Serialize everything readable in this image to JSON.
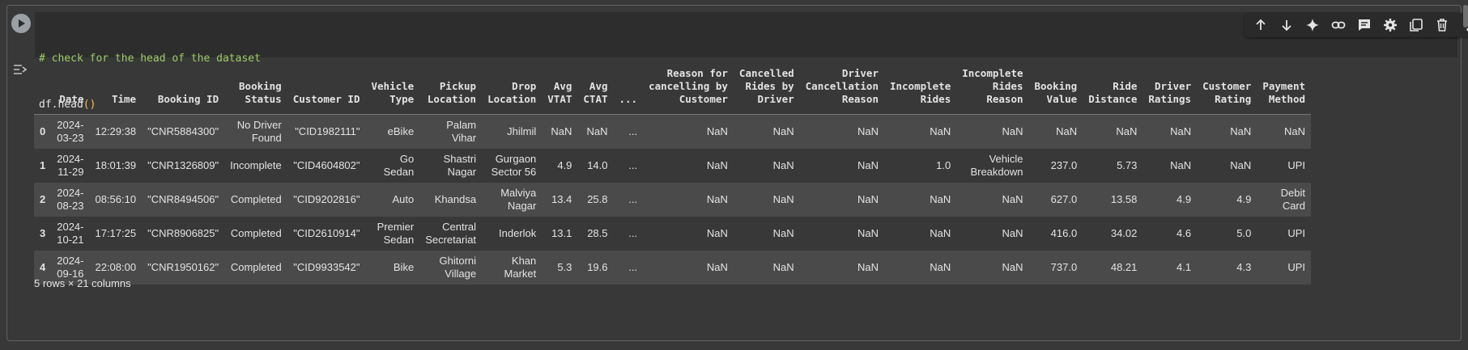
{
  "code": {
    "comment": "# check for the head of the dataset",
    "line2_prefix": "df.head",
    "line2_parens": "()"
  },
  "toolbar": {
    "icons": [
      "arrow-up-icon",
      "arrow-down-icon",
      "sparkle-icon",
      "link-icon",
      "comment-icon",
      "gear-icon",
      "mirror-cell-icon",
      "delete-icon",
      "more-vert-icon"
    ]
  },
  "table": {
    "index_header": "",
    "columns": [
      "Date",
      "Time",
      "Booking ID",
      "Booking Status",
      "Customer ID",
      "Vehicle Type",
      "Pickup Location",
      "Drop Location",
      "Avg VTAT",
      "Avg CTAT",
      "...",
      "Reason for cancelling by Customer",
      "Cancelled Rides by Driver",
      "Driver Cancellation Reason",
      "Incomplete Rides",
      "Incomplete Rides Reason",
      "Booking Value",
      "Ride Distance",
      "Driver Ratings",
      "Customer Rating",
      "Payment Method"
    ],
    "header_lines": [
      [
        "",
        "Date"
      ],
      [
        "",
        "Time"
      ],
      [
        "",
        "Booking ID"
      ],
      [
        "Booking",
        "Status"
      ],
      [
        "",
        "Customer ID"
      ],
      [
        "Vehicle",
        "Type"
      ],
      [
        "Pickup",
        "Location"
      ],
      [
        "Drop",
        "Location"
      ],
      [
        "Avg",
        "VTAT"
      ],
      [
        "Avg",
        "CTAT"
      ],
      [
        "",
        "..."
      ],
      [
        "Reason for",
        "cancelling by",
        "Customer"
      ],
      [
        "Cancelled",
        "Rides by",
        "Driver"
      ],
      [
        "Driver",
        "Cancellation",
        "Reason"
      ],
      [
        "Incomplete",
        "Rides"
      ],
      [
        "Incomplete",
        "Rides",
        "Reason"
      ],
      [
        "Booking",
        "Value"
      ],
      [
        "Ride",
        "Distance"
      ],
      [
        "Driver",
        "Ratings"
      ],
      [
        "Customer",
        "Rating"
      ],
      [
        "Payment",
        "Method"
      ]
    ],
    "rows": [
      {
        "index": "0",
        "cells": [
          [
            "2024-",
            "03-23"
          ],
          [
            "12:29:38"
          ],
          [
            "\"CNR5884300\""
          ],
          [
            "No Driver",
            "Found"
          ],
          [
            "\"CID1982111\""
          ],
          [
            "eBike"
          ],
          [
            "Palam",
            "Vihar"
          ],
          [
            "Jhilmil"
          ],
          [
            "NaN"
          ],
          [
            "NaN"
          ],
          [
            "..."
          ],
          [
            "NaN"
          ],
          [
            "NaN"
          ],
          [
            "NaN"
          ],
          [
            "NaN"
          ],
          [
            "NaN"
          ],
          [
            "NaN"
          ],
          [
            "NaN"
          ],
          [
            "NaN"
          ],
          [
            "NaN"
          ],
          [
            "NaN"
          ]
        ]
      },
      {
        "index": "1",
        "cells": [
          [
            "2024-",
            "11-29"
          ],
          [
            "18:01:39"
          ],
          [
            "\"CNR1326809\""
          ],
          [
            "Incomplete"
          ],
          [
            "\"CID4604802\""
          ],
          [
            "Go",
            "Sedan"
          ],
          [
            "Shastri",
            "Nagar"
          ],
          [
            "Gurgaon",
            "Sector 56"
          ],
          [
            "4.9"
          ],
          [
            "14.0"
          ],
          [
            "..."
          ],
          [
            "NaN"
          ],
          [
            "NaN"
          ],
          [
            "NaN"
          ],
          [
            "1.0"
          ],
          [
            "Vehicle",
            "Breakdown"
          ],
          [
            "237.0"
          ],
          [
            "5.73"
          ],
          [
            "NaN"
          ],
          [
            "NaN"
          ],
          [
            "UPI"
          ]
        ]
      },
      {
        "index": "2",
        "cells": [
          [
            "2024-",
            "08-23"
          ],
          [
            "08:56:10"
          ],
          [
            "\"CNR8494506\""
          ],
          [
            "Completed"
          ],
          [
            "\"CID9202816\""
          ],
          [
            "Auto"
          ],
          [
            "Khandsa"
          ],
          [
            "Malviya",
            "Nagar"
          ],
          [
            "13.4"
          ],
          [
            "25.8"
          ],
          [
            "..."
          ],
          [
            "NaN"
          ],
          [
            "NaN"
          ],
          [
            "NaN"
          ],
          [
            "NaN"
          ],
          [
            "NaN"
          ],
          [
            "627.0"
          ],
          [
            "13.58"
          ],
          [
            "4.9"
          ],
          [
            "4.9"
          ],
          [
            "Debit",
            "Card"
          ]
        ]
      },
      {
        "index": "3",
        "cells": [
          [
            "2024-",
            "10-21"
          ],
          [
            "17:17:25"
          ],
          [
            "\"CNR8906825\""
          ],
          [
            "Completed"
          ],
          [
            "\"CID2610914\""
          ],
          [
            "Premier",
            "Sedan"
          ],
          [
            "Central",
            "Secretariat"
          ],
          [
            "Inderlok"
          ],
          [
            "13.1"
          ],
          [
            "28.5"
          ],
          [
            "..."
          ],
          [
            "NaN"
          ],
          [
            "NaN"
          ],
          [
            "NaN"
          ],
          [
            "NaN"
          ],
          [
            "NaN"
          ],
          [
            "416.0"
          ],
          [
            "34.02"
          ],
          [
            "4.6"
          ],
          [
            "5.0"
          ],
          [
            "UPI"
          ]
        ]
      },
      {
        "index": "4",
        "cells": [
          [
            "2024-",
            "09-16"
          ],
          [
            "22:08:00"
          ],
          [
            "\"CNR1950162\""
          ],
          [
            "Completed"
          ],
          [
            "\"CID9933542\""
          ],
          [
            "Bike"
          ],
          [
            "Ghitorni",
            "Village"
          ],
          [
            "Khan",
            "Market"
          ],
          [
            "5.3"
          ],
          [
            "19.6"
          ],
          [
            "..."
          ],
          [
            "NaN"
          ],
          [
            "NaN"
          ],
          [
            "NaN"
          ],
          [
            "NaN"
          ],
          [
            "NaN"
          ],
          [
            "737.0"
          ],
          [
            "48.21"
          ],
          [
            "4.1"
          ],
          [
            "4.3"
          ],
          [
            "UPI"
          ]
        ]
      }
    ],
    "shape_text": "5 rows × 21 columns"
  },
  "colors": {
    "background": "#383838",
    "code_background": "#2d2d2d",
    "comment": "#9ccc65",
    "paren": "#f7c244",
    "row_alt": "#4a4a4a"
  }
}
